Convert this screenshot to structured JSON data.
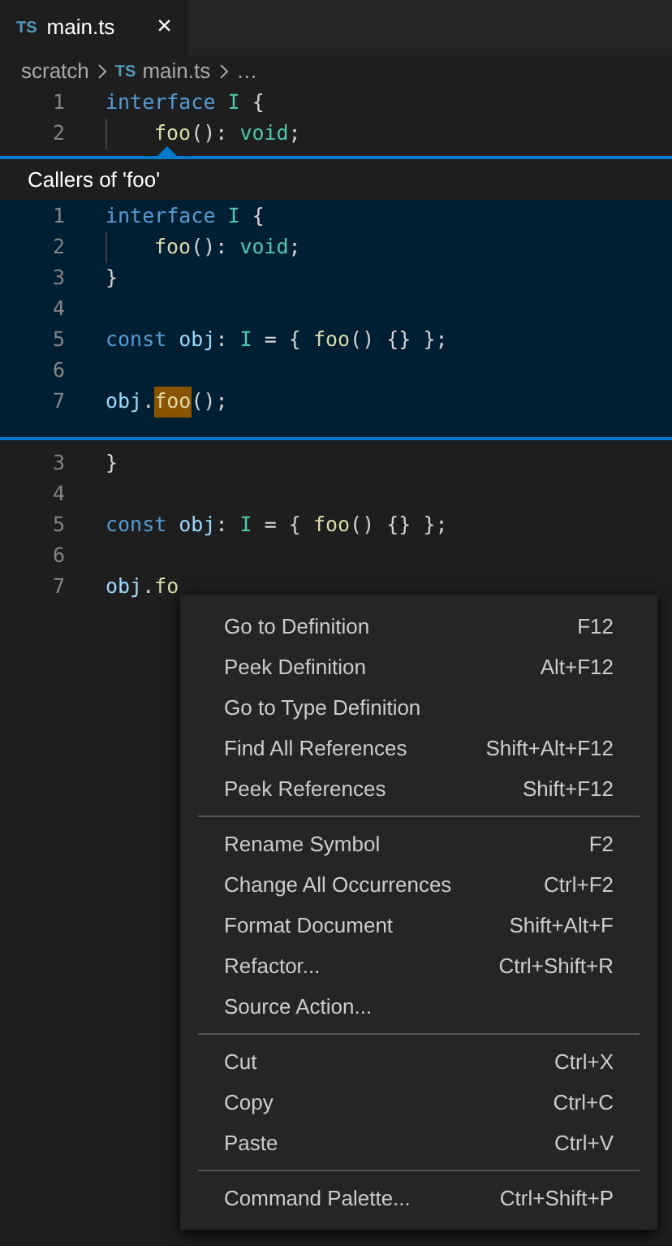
{
  "tab": {
    "icon": "TS",
    "label": "main.ts",
    "close": "×",
    "selected": true
  },
  "breadcrumb": [
    {
      "label": "scratch"
    },
    {
      "icon": "TS",
      "label": "main.ts"
    },
    {
      "label": "…"
    }
  ],
  "editor_top": [
    {
      "number": "1",
      "indented": false,
      "tokens": [
        {
          "kind": "keyword",
          "text": "interface "
        },
        {
          "kind": "type",
          "text": "I "
        },
        {
          "kind": "punct",
          "text": "{"
        }
      ]
    },
    {
      "number": "2",
      "indented": true,
      "tokens": [
        {
          "kind": "function",
          "text": "foo"
        },
        {
          "kind": "punct",
          "text": "(): "
        },
        {
          "kind": "type",
          "text": "void"
        },
        {
          "kind": "punct",
          "text": ";"
        }
      ]
    }
  ],
  "peek": {
    "title": "Callers of 'foo'",
    "lines": [
      {
        "number": "1",
        "indented": false,
        "tokens": [
          {
            "kind": "keyword",
            "text": "interface "
          },
          {
            "kind": "type",
            "text": "I "
          },
          {
            "kind": "punct",
            "text": "{"
          }
        ]
      },
      {
        "number": "2",
        "indented": true,
        "tokens": [
          {
            "kind": "function",
            "text": "foo"
          },
          {
            "kind": "punct",
            "text": "(): "
          },
          {
            "kind": "type",
            "text": "void"
          },
          {
            "kind": "punct",
            "text": ";"
          }
        ]
      },
      {
        "number": "3",
        "indented": false,
        "tokens": [
          {
            "kind": "punct",
            "text": "}"
          }
        ]
      },
      {
        "number": "4",
        "indented": false
      },
      {
        "number": "5",
        "indented": false,
        "tokens": [
          {
            "kind": "keyword",
            "text": "const "
          },
          {
            "kind": "variable",
            "text": "obj"
          },
          {
            "kind": "punct",
            "text": ": "
          },
          {
            "kind": "type",
            "text": "I "
          },
          {
            "kind": "punct",
            "text": "= { "
          },
          {
            "kind": "function",
            "text": "foo"
          },
          {
            "kind": "punct",
            "text": "() {} };"
          }
        ]
      },
      {
        "number": "6",
        "indented": false
      },
      {
        "number": "7",
        "indented": false,
        "tokens": [
          {
            "kind": "variable",
            "text": "obj"
          },
          {
            "kind": "punct",
            "text": "."
          },
          {
            "kind": "function",
            "text": "foo",
            "highlighted": true
          },
          {
            "kind": "punct",
            "text": "();"
          }
        ]
      }
    ]
  },
  "editor_bottom": [
    {
      "number": "3",
      "indented": false,
      "tokens": [
        {
          "kind": "punct",
          "text": "}"
        }
      ]
    },
    {
      "number": "4",
      "indented": false
    },
    {
      "number": "5",
      "indented": false,
      "tokens": [
        {
          "kind": "keyword",
          "text": "const "
        },
        {
          "kind": "variable",
          "text": "obj"
        },
        {
          "kind": "punct",
          "text": ": "
        },
        {
          "kind": "type",
          "text": "I "
        },
        {
          "kind": "punct",
          "text": "= { "
        },
        {
          "kind": "function",
          "text": "foo"
        },
        {
          "kind": "punct",
          "text": "() {} };"
        }
      ]
    },
    {
      "number": "6",
      "indented": false
    },
    {
      "number": "7",
      "indented": false,
      "tokens": [
        {
          "kind": "variable",
          "text": "obj"
        },
        {
          "kind": "punct",
          "text": "."
        },
        {
          "kind": "function",
          "text": "fo"
        }
      ]
    }
  ],
  "context_menu": [
    [
      {
        "label": "Go to Definition",
        "shortcut": "F12"
      },
      {
        "label": "Peek Definition",
        "shortcut": "Alt+F12"
      },
      {
        "label": "Go to Type Definition"
      },
      {
        "label": "Find All References",
        "shortcut": "Shift+Alt+F12"
      },
      {
        "label": "Peek References",
        "shortcut": "Shift+F12"
      }
    ],
    [
      {
        "label": "Rename Symbol",
        "shortcut": "F2"
      },
      {
        "label": "Change All Occurrences",
        "shortcut": "Ctrl+F2"
      },
      {
        "label": "Format Document",
        "shortcut": "Shift+Alt+F"
      },
      {
        "label": "Refactor...",
        "shortcut": "Ctrl+Shift+R"
      },
      {
        "label": "Source Action..."
      }
    ],
    [
      {
        "label": "Cut",
        "shortcut": "Ctrl+X"
      },
      {
        "label": "Copy",
        "shortcut": "Ctrl+C"
      },
      {
        "label": "Paste",
        "shortcut": "Ctrl+V"
      }
    ],
    [
      {
        "label": "Command Palette...",
        "shortcut": "Ctrl+Shift+P"
      }
    ]
  ]
}
